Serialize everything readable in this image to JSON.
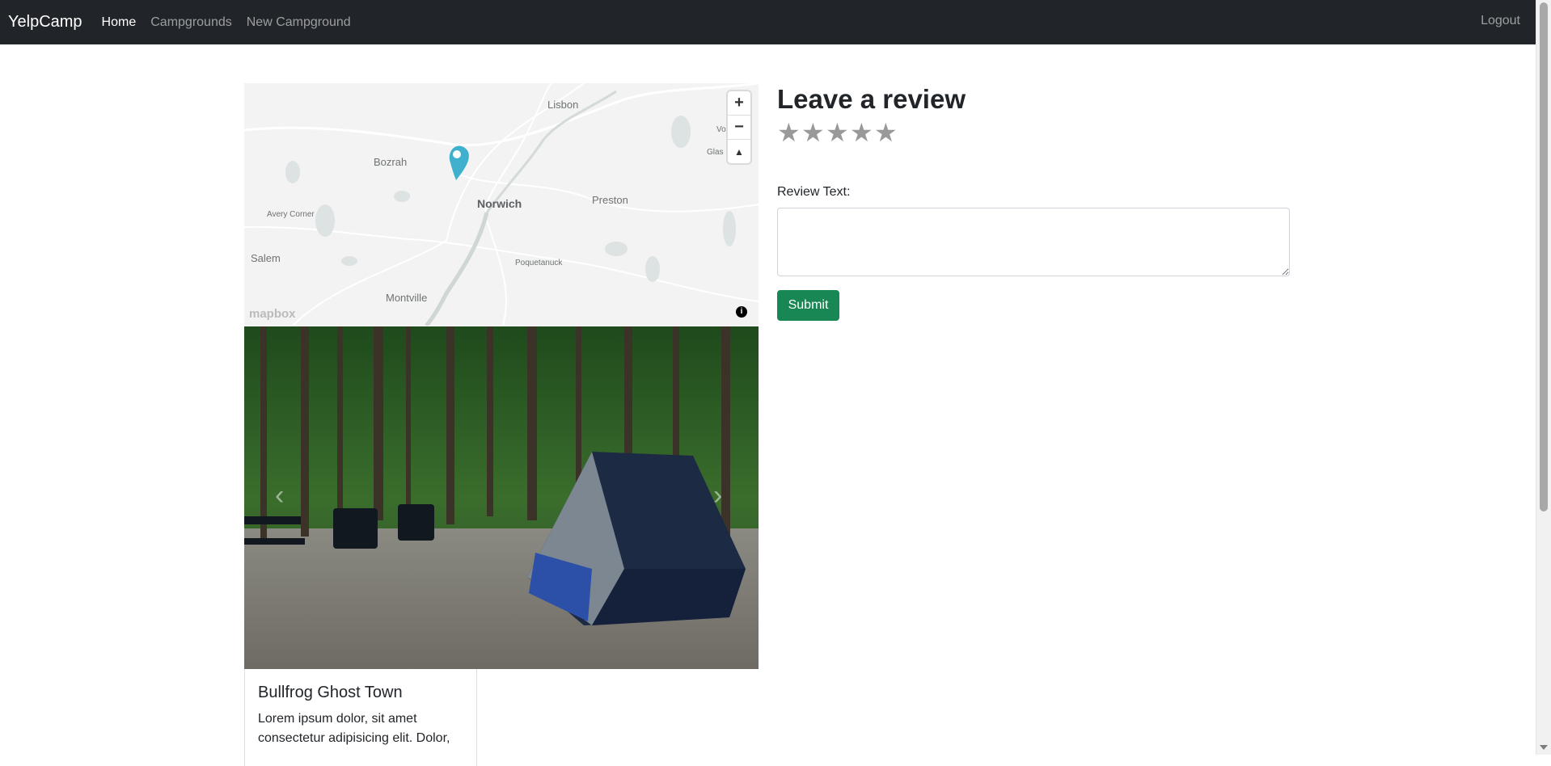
{
  "navbar": {
    "brand": "YelpCamp",
    "links": [
      {
        "label": "Home"
      },
      {
        "label": "Campgrounds"
      },
      {
        "label": "New Campground"
      }
    ],
    "logout": "Logout"
  },
  "map": {
    "labels": [
      "Lisbon",
      "Bozrah",
      "Norwich",
      "Preston",
      "Avery Corner",
      "Salem",
      "Poquetanuck",
      "Montville",
      "Vo",
      "Glas"
    ],
    "controls": {
      "zoom_in": "+",
      "zoom_out": "−",
      "compass": "▲"
    },
    "attribution_logo": "mapbox",
    "info": "i",
    "marker_color": "#3fb1ce"
  },
  "carousel": {
    "prev": "‹",
    "next": "›"
  },
  "campground": {
    "title": "Bullfrog Ghost Town",
    "description": "Lorem ipsum dolor, sit amet consectetur adipisicing elit. Dolor,"
  },
  "review": {
    "heading": "Leave a review",
    "rating_stars": 5,
    "star_glyph": "★",
    "label": "Review Text:",
    "textarea_value": "",
    "submit": "Submit"
  },
  "colors": {
    "navbar_bg": "#212529",
    "submit_bg": "#198754",
    "star": "#999999"
  }
}
